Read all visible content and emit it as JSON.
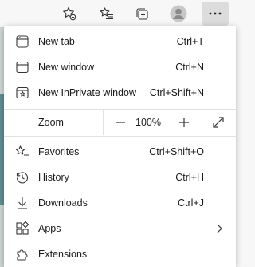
{
  "toolbar": {
    "icons": [
      "favorite-add-icon",
      "favorites-list-icon",
      "collections-icon",
      "profile-avatar-icon",
      "more-options-icon"
    ]
  },
  "menu": {
    "items_top": [
      {
        "label": "New tab",
        "shortcut": "Ctrl+T",
        "icon": "new-tab-icon"
      },
      {
        "label": "New window",
        "shortcut": "Ctrl+N",
        "icon": "new-window-icon"
      },
      {
        "label": "New InPrivate window",
        "shortcut": "Ctrl+Shift+N",
        "icon": "inprivate-icon"
      }
    ],
    "zoom": {
      "label": "Zoom",
      "value": "100%",
      "decrease_icon": "minus-icon",
      "increase_icon": "plus-icon",
      "fullscreen_icon": "fullscreen-icon"
    },
    "items_bottom": [
      {
        "label": "Favorites",
        "shortcut": "Ctrl+Shift+O",
        "icon": "star-list-icon"
      },
      {
        "label": "History",
        "shortcut": "Ctrl+H",
        "icon": "history-icon"
      },
      {
        "label": "Downloads",
        "shortcut": "Ctrl+J",
        "icon": "download-icon"
      },
      {
        "label": "Apps",
        "shortcut": "",
        "icon": "apps-icon"
      },
      {
        "label": "Extensions",
        "shortcut": "",
        "icon": "extensions-icon"
      }
    ]
  }
}
